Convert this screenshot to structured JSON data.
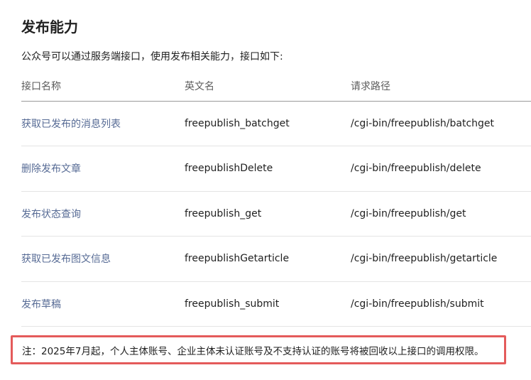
{
  "page": {
    "title": "发布能力",
    "intro": "公众号可以通过服务端接口，使用发布相关能力，接口如下:"
  },
  "table": {
    "headers": {
      "name": "接口名称",
      "english": "英文名",
      "path": "请求路径"
    },
    "rows": [
      {
        "name": "获取已发布的消息列表",
        "english": "freepublish_batchget",
        "path": "/cgi-bin/freepublish/batchget"
      },
      {
        "name": "删除发布文章",
        "english": "freepublishDelete",
        "path": "/cgi-bin/freepublish/delete"
      },
      {
        "name": "发布状态查询",
        "english": "freepublish_get",
        "path": "/cgi-bin/freepublish/get"
      },
      {
        "name": "获取已发布图文信息",
        "english": "freepublishGetarticle",
        "path": "/cgi-bin/freepublish/getarticle"
      },
      {
        "name": "发布草稿",
        "english": "freepublish_submit",
        "path": "/cgi-bin/freepublish/submit"
      }
    ]
  },
  "note": {
    "text": "注：2025年7月起，个人主体账号、企业主体未认证账号及不支持认证的账号将被回收以上接口的调用权限。"
  },
  "colors": {
    "link": "#576b95",
    "highlight_border": "#e45b5b",
    "header_divider": "#9a9a9a",
    "row_divider": "#e4e4e4"
  }
}
